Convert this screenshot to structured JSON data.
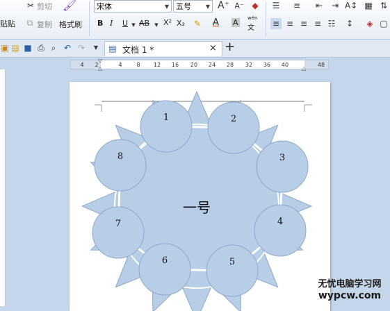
{
  "toolbar": {
    "paste": "贴贴",
    "cut": "剪切",
    "copy": "复制",
    "format_painter": "格式刷",
    "font_name": "宋体",
    "font_size": "五号",
    "pinyin_top": "wén",
    "pinyin_bottom": "文",
    "bold": "B",
    "italic": "I",
    "underline": "U",
    "strike": "AB",
    "superscript": "X²",
    "subscript": "X₂",
    "font_color": "A",
    "char_shading": "A"
  },
  "tabs": {
    "document_tab": "文档 1 *",
    "close": "×",
    "new_tab": "+"
  },
  "ruler": {
    "labels": [
      "4",
      "2",
      "4",
      "8",
      "12",
      "16",
      "20",
      "24",
      "28",
      "32",
      "36",
      "40",
      "48"
    ]
  },
  "diagram": {
    "center_label": "一号",
    "node_labels": [
      "1",
      "2",
      "3",
      "4",
      "5",
      "6",
      "7",
      "8"
    ],
    "colors": {
      "fill": "#b8cde6",
      "stroke": "#8ea9cc"
    }
  },
  "watermark": {
    "line1": "无忧电脑学习网",
    "line2": "wypcw.com"
  }
}
